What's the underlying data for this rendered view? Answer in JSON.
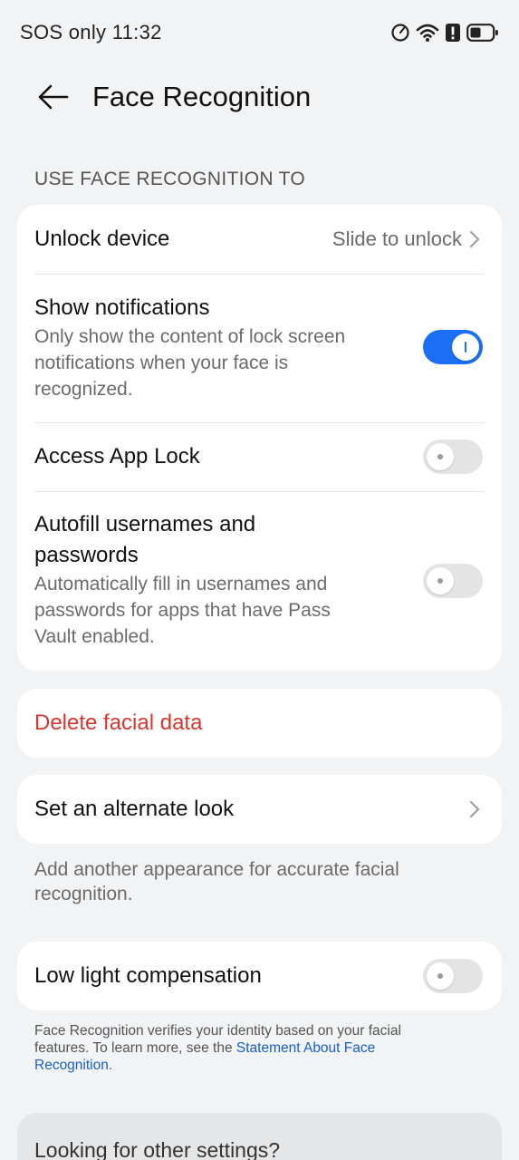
{
  "status_bar": {
    "left_text": "SOS only 11:32",
    "icons": [
      "speed-meter-icon",
      "wifi-icon",
      "alert-icon",
      "battery-icon"
    ]
  },
  "header": {
    "back_icon": "arrow-left-icon",
    "title": "Face Recognition"
  },
  "section": {
    "header": "USE FACE RECOGNITION TO"
  },
  "settings": {
    "unlock_device": {
      "label": "Unlock device",
      "value": "Slide to unlock"
    },
    "show_notifications": {
      "label": "Show notifications",
      "sub_line1": "Only show the content of lock screen",
      "sub_line2": "notifications when your face is",
      "sub_line3": "recognized.",
      "enabled": true
    },
    "access_app_lock": {
      "label": "Access App Lock",
      "enabled": false
    },
    "autofill": {
      "label_line1": "Autofill usernames and",
      "label_line2": "passwords",
      "sub_line1": "Automatically fill in usernames and",
      "sub_line2": "passwords for apps that have Pass",
      "sub_line3": "Vault enabled.",
      "enabled": false
    }
  },
  "delete": {
    "label": "Delete facial data"
  },
  "alternate_look": {
    "label": "Set an alternate look",
    "helper_line1": "Add another appearance for accurate facial",
    "helper_line2": "recognition."
  },
  "low_light": {
    "label": "Low light compensation",
    "enabled": false
  },
  "footnote": {
    "text_line1": "Face Recognition verifies your identity based on your facial",
    "text_line2": "features. To learn more, see the ",
    "link_part1": "Statement About Face",
    "link_part2": "Recognition",
    "end": "."
  },
  "looking": {
    "label": "Looking for other settings?"
  },
  "colors": {
    "background": "#f1f3f5",
    "card": "#ffffff",
    "accent": "#1a6ff5",
    "danger": "#d6382e",
    "link": "#1a5fc8"
  }
}
